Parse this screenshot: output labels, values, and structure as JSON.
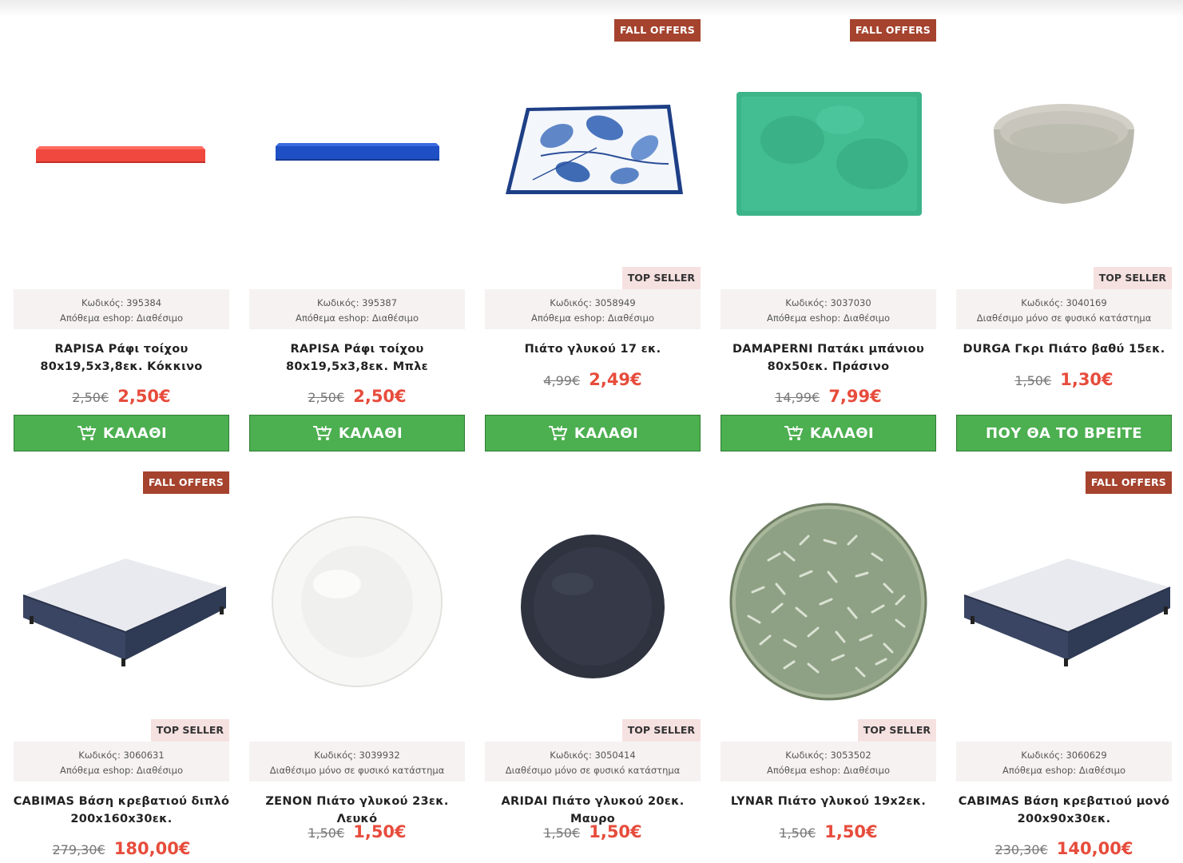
{
  "badges": {
    "fall": "FALL OFFERS",
    "top": "TOP SELLER"
  },
  "buttons": {
    "cart": "ΚΑΛΑΘΙ",
    "find": "ΠΟΥ ΘΑ ΤΟ ΒΡΕΙΤΕ"
  },
  "products": [
    {
      "code": "Κωδικός: 395384",
      "stock": "Απόθεμα eshop: Διαθέσιμο",
      "title_line1": "RAPISA Ράφι τοίχου",
      "title_line2": "80x19,5x3,8εκ. Κόκκινο",
      "old_price": "2,50€",
      "new_price": "2,50€",
      "image": "red-shelf"
    },
    {
      "code": "Κωδικός: 395387",
      "stock": "Απόθεμα eshop: Διαθέσιμο",
      "title_line1": "RAPISA Ράφι τοίχου",
      "title_line2": "80x19,5x3,8εκ. Μπλε",
      "old_price": "2,50€",
      "new_price": "2,50€",
      "image": "blue-shelf"
    },
    {
      "code": "Κωδικός: 3058949",
      "stock": "Απόθεμα eshop: Διαθέσιμο",
      "title_line1": "Πιάτο γλυκού 17 εκ.",
      "title_line2": "",
      "old_price": "4,99€",
      "new_price": "2,49€",
      "image": "blue-lemon-plate"
    },
    {
      "code": "Κωδικός: 3037030",
      "stock": "Απόθεμα eshop: Διαθέσιμο",
      "title_line1": "DAMAPERNI Πατάκι μπάνιου",
      "title_line2": "80x50εκ. Πράσινο",
      "old_price": "14,99€",
      "new_price": "7,99€",
      "image": "green-bath-mat"
    },
    {
      "code": "Κωδικός: 3040169",
      "stock": "Διαθέσιμο μόνο σε φυσικό κατάστημα",
      "title_line1": "DURGA Γκρι Πιάτο βαθύ 15εκ.",
      "title_line2": "",
      "old_price": "1,50€",
      "new_price": "1,30€",
      "image": "grey-bowl"
    },
    {
      "code": "Κωδικός: 3060631",
      "stock": "Απόθεμα eshop: Διαθέσιμο",
      "title_line1": "CABIMAS Βάση κρεβατιού διπλό",
      "title_line2": "200x160x30εκ.",
      "old_price": "279,30€",
      "new_price": "180,00€",
      "image": "bed-base"
    },
    {
      "code": "Κωδικός: 3039932",
      "stock": "Διαθέσιμο μόνο σε φυσικό κατάστημα",
      "title_line1": "ZENON Πιάτο γλυκού 23εκ. Λευκό",
      "title_line2": "",
      "old_price": "1,50€",
      "new_price": "1,50€",
      "image": "white-plate"
    },
    {
      "code": "Κωδικός: 3050414",
      "stock": "Διαθέσιμο μόνο σε φυσικό κατάστημα",
      "title_line1": "ARIDAI Πιάτο γλυκού 20εκ. Μαυρο",
      "title_line2": "",
      "old_price": "1,50€",
      "new_price": "1,50€",
      "image": "black-plate"
    },
    {
      "code": "Κωδικός: 3053502",
      "stock": "Απόθεμα eshop: Διαθέσιμο",
      "title_line1": "LYNAR Πιάτο γλυκού 19x2εκ.",
      "title_line2": "",
      "old_price": "1,50€",
      "new_price": "1,50€",
      "image": "green-leaf-plate"
    },
    {
      "code": "Κωδικός: 3060629",
      "stock": "Απόθεμα eshop: Διαθέσιμο",
      "title_line1": "CABIMAS Βάση κρεβατιού μονό",
      "title_line2": "200x90x30εκ.",
      "old_price": "230,30€",
      "new_price": "140,00€",
      "image": "bed-base"
    }
  ]
}
